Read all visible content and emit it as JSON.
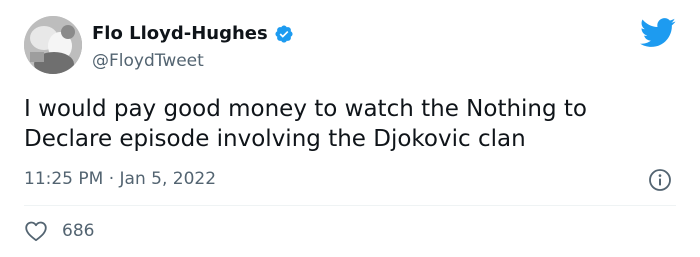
{
  "user": {
    "display_name": "Flo Lloyd-Hughes",
    "handle": "@FloydTweet",
    "verified": true
  },
  "tweet": {
    "text": "I would pay good money to watch the Nothing to Declare episode involving the Djokovic clan",
    "time": "11:25 PM",
    "separator": "·",
    "date": "Jan 5, 2022"
  },
  "engagement": {
    "likes": "686"
  },
  "icons": {
    "brand": "twitter-bird-icon",
    "verified": "verified-badge-icon",
    "info": "info-icon",
    "like": "heart-icon"
  },
  "colors": {
    "brand_blue": "#1d9bf0",
    "text": "#0f1419",
    "secondary": "#536471",
    "divider": "#eff3f4"
  }
}
